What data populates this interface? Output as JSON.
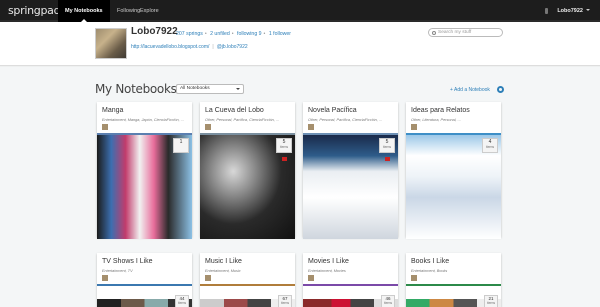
{
  "app": {
    "logo": "springpad",
    "user": "Lobo7922"
  },
  "nav": [
    {
      "label": "My Notebooks"
    },
    {
      "label": "Following"
    },
    {
      "label": "Explore"
    }
  ],
  "profile": {
    "name": "Lobo7922",
    "springs": "207 springs",
    "unfiled": "2 unfiled",
    "following": "following 9",
    "followers": "1 follower",
    "blog": "http://lacuevadellobo.blogspot.com/",
    "twitter": "@jb.lobo7922"
  },
  "search": {
    "placeholder": "Search my stuff"
  },
  "page": {
    "title": "My Notebooks",
    "filter": "All Notebooks",
    "add": "+ Add a Notebook"
  },
  "notebooks": [
    {
      "title": "Manga",
      "tags": "Entertainment, Manga, Japón, CienciaFicción, ...",
      "count": "1",
      "unit": "",
      "bar": "#5b7fb0"
    },
    {
      "title": "La Cueva del Lobo",
      "tags": "Other, Personal, Pacífica, CienciaFicción, ...",
      "count": "5",
      "unit": "items",
      "bar": "#7a8f9f"
    },
    {
      "title": "Novela Pacífica",
      "tags": "Other, Personal, Pacífica, CienciaFicción, ...",
      "count": "5",
      "unit": "items",
      "bar": "#6d90b5"
    },
    {
      "title": "Ideas para Relatos",
      "tags": "Other, Literatura, Personal, ...",
      "count": "4",
      "unit": "items",
      "bar": "#3e8fc7"
    },
    {
      "title": "TV Shows I Like",
      "tags": "Entertainment, TV",
      "count": "44",
      "unit": "items",
      "bar": "#3b78b0"
    },
    {
      "title": "Music I Like",
      "tags": "Entertainment, Music",
      "count": "67",
      "unit": "items",
      "bar": "#b07d3b"
    },
    {
      "title": "Movies I Like",
      "tags": "Entertainment, Movies",
      "count": "46",
      "unit": "items",
      "bar": "#7b4aa8"
    },
    {
      "title": "Books I Like",
      "tags": "Entertainment, Books",
      "count": "21",
      "unit": "items",
      "bar": "#2c8a4a"
    }
  ],
  "colors": {
    "accent": "#2d7fb8",
    "topbar": "#1d1d1d"
  }
}
